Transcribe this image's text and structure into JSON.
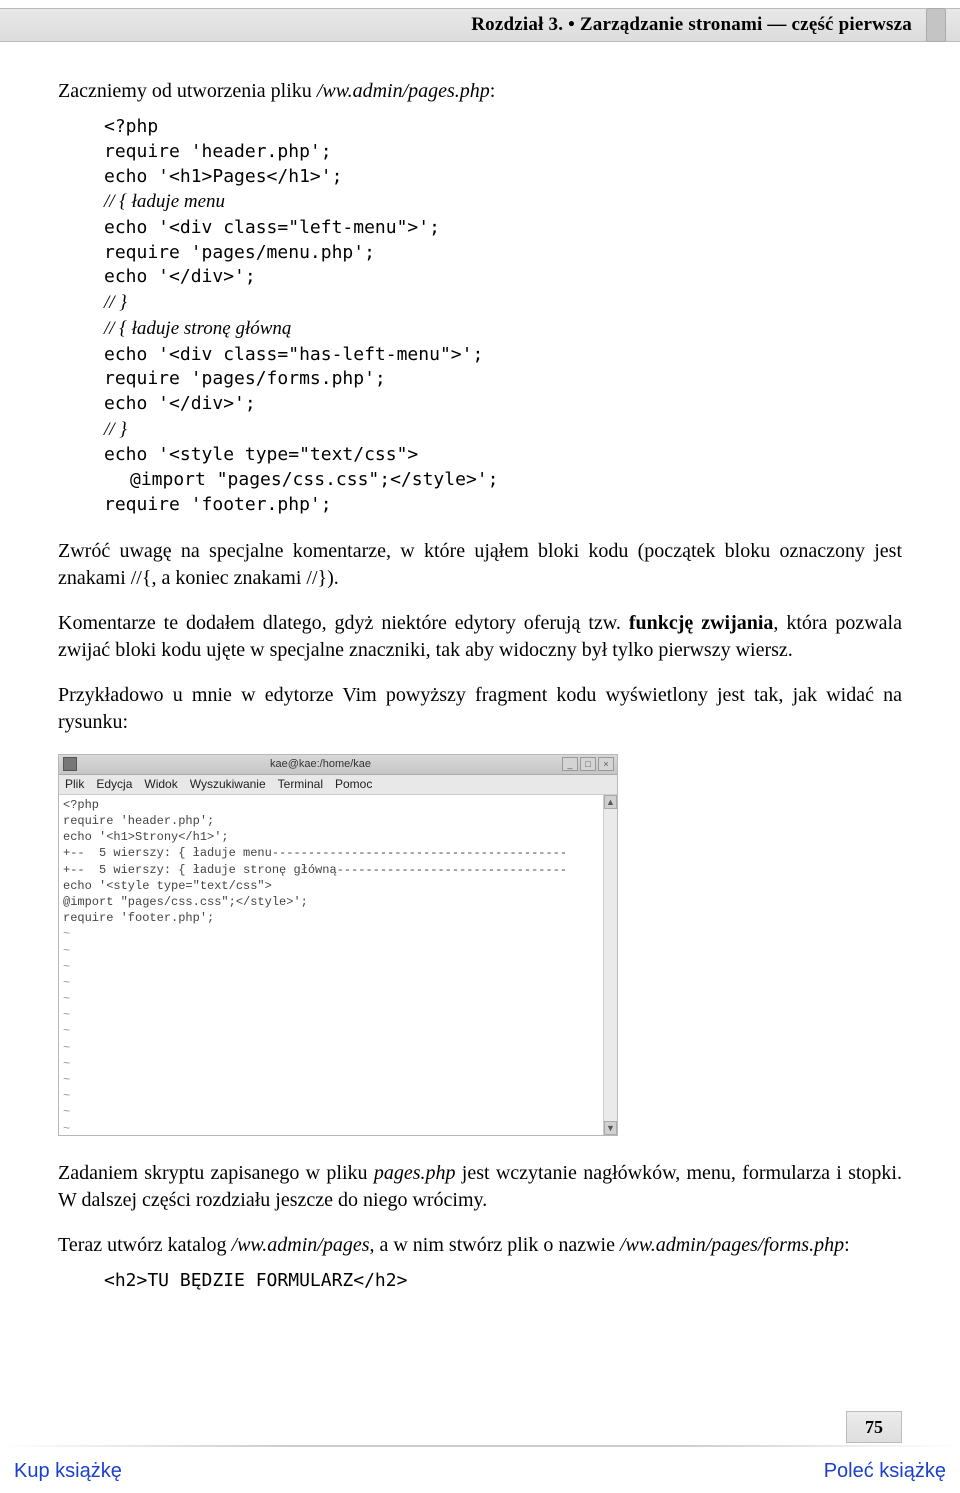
{
  "header": {
    "chapter_title": "Rozdział 3. • Zarządzanie stronami — część pierwsza"
  },
  "intro": {
    "prefix": "Zaczniemy od utworzenia pliku ",
    "path": "/ww.admin/pages.php",
    "suffix": ":"
  },
  "code1": {
    "l01": "<?php",
    "l02": "require 'header.php';",
    "l03": "echo '<h1>Pages</h1>';",
    "l04_cmt": "// { ładuje menu",
    "l05": "echo '<div class=\"left-menu\">';",
    "l06": "require 'pages/menu.php';",
    "l07": "echo '</div>';",
    "l08_cmt": "// }",
    "l09_cmt": "// { ładuje stronę główną",
    "l10": "echo '<div class=\"has-left-menu\">';",
    "l11": "require 'pages/forms.php';",
    "l12": "echo '</div>';",
    "l13_cmt": "// }",
    "l14": "echo '<style type=\"text/css\">",
    "l15": "@import \"pages/css.css\";</style>';",
    "l16": "require 'footer.php';"
  },
  "para1": "Zwróć uwagę na specjalne komentarze, w które ująłem bloki kodu (początek bloku oznaczony jest znakami //{, a koniec znakami //}).",
  "para2": {
    "p1": "Komentarze te dodałem dlatego, gdyż niektóre edytory oferują tzw. ",
    "bold": "funkcję zwijania",
    "p2": ", która pozwala zwijać bloki kodu ujęte w specjalne znaczniki, tak aby widoczny był tylko pierwszy wiersz."
  },
  "para3": "Przykładowo u mnie w edytorze Vim powyższy fragment kodu wyświetlony jest tak, jak widać na rysunku:",
  "screenshot": {
    "window_title": "kae@kae:/home/kae",
    "menu": {
      "m1": "Plik",
      "m2": "Edycja",
      "m3": "Widok",
      "m4": "Wyszukiwanie",
      "m5": "Terminal",
      "m6": "Pomoc"
    },
    "btn_min": "_",
    "btn_max": "□",
    "btn_close": "×",
    "arrow_up": "▲",
    "arrow_down": "▼",
    "lines": {
      "l1": "<?php",
      "l2": "require 'header.php';",
      "l3": "echo '<h1>Strony</h1>';",
      "l4": "+--  5 wierszy: { ładuje menu-----------------------------------------",
      "l5": "+--  5 wierszy: { ładuje stronę główną--------------------------------",
      "l6": "echo '<style type=\"text/css\">",
      "l7": "@import \"pages/css.css\";</style>';",
      "l8": "require 'footer.php';"
    },
    "tilde": "~"
  },
  "para4": {
    "p1": "Zadaniem skryptu zapisanego w pliku ",
    "it1": "pages.php",
    "p2": " jest wczytanie nagłówków, menu, formularza i stopki. W dalszej części rozdziału jeszcze do niego wrócimy."
  },
  "para5": {
    "p1": "Teraz utwórz katalog ",
    "it1": "/ww.admin/pages",
    "p2": ", a w nim stwórz plik o nazwie ",
    "it2": "/ww.admin/pages/forms.php",
    "p3": ":"
  },
  "code2": {
    "l1": "<h2>TU BĘDZIE FORMULARZ</h2>"
  },
  "footer": {
    "page_number": "75",
    "buy_link": "Kup książkę",
    "recommend_link": "Poleć książkę"
  }
}
